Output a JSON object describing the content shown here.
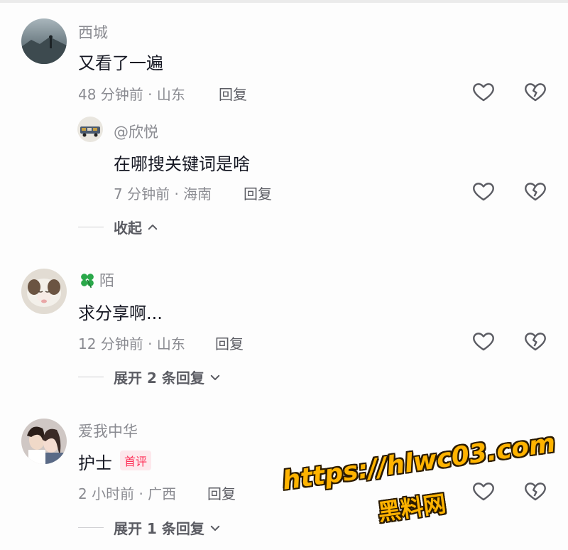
{
  "comments": [
    {
      "username": "西城",
      "text": "又看了一遍",
      "meta": "48 分钟前 · 山东",
      "reply_label": "回复"
    },
    {
      "username": "@欣悦",
      "text": "在哪搜关键词是啥",
      "meta": "7 分钟前 · 海南",
      "reply_label": "回复"
    },
    {
      "username": "陌",
      "text": "求分享啊...",
      "meta": "12 分钟前 · 山东",
      "reply_label": "回复"
    },
    {
      "username": "爱我中华",
      "text": "护士",
      "tag": "首评",
      "meta": "2 小时前 · 广西",
      "reply_label": "回复"
    }
  ],
  "expanders": {
    "collapse": "收起",
    "expand_2": "展开 2 条回复",
    "expand_1": "展开 1 条回复"
  },
  "icons": {
    "like": "heart-outline-icon",
    "dislike": "broken-heart-icon",
    "clover": "four-leaf-clover-icon",
    "chevron_up": "chevron-up-icon",
    "chevron_down": "chevron-down-icon"
  },
  "colors": {
    "text_primary": "#161823",
    "text_secondary": "#8a8b91",
    "tag_red": "#fe2c55",
    "watermark": "#ffb300"
  },
  "watermark": {
    "url": "https://hlwc03.com",
    "name": "黑料网"
  }
}
